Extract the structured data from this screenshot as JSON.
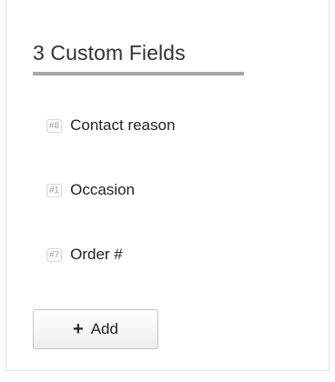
{
  "panel": {
    "title": "3 Custom Fields"
  },
  "fields": [
    {
      "id": "#8",
      "name": "Contact reason"
    },
    {
      "id": "#1",
      "name": "Occasion"
    },
    {
      "id": "#7",
      "name": "Order #"
    }
  ],
  "add_button": {
    "icon": "plus-icon",
    "glyph": "+",
    "label": "Add"
  }
}
